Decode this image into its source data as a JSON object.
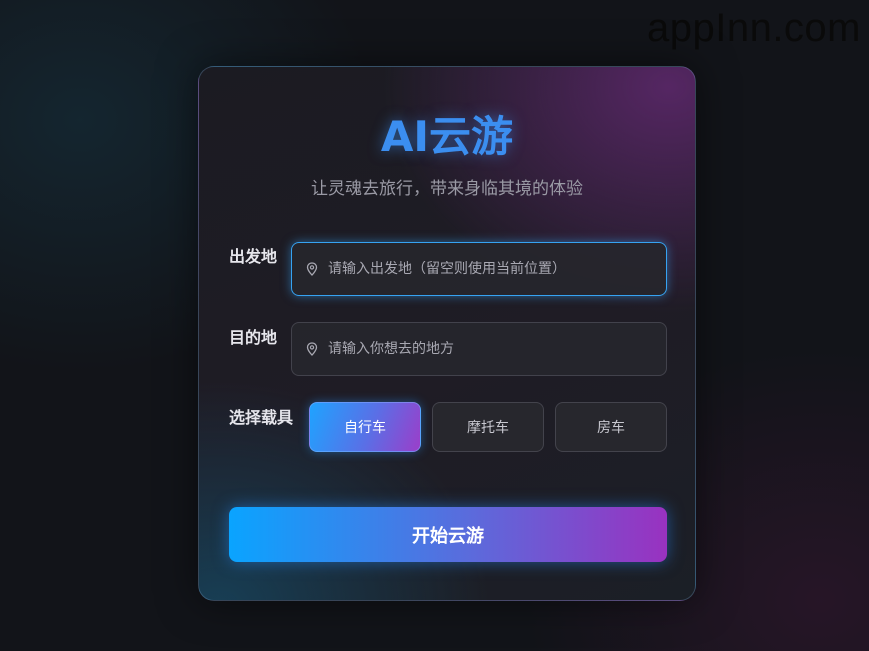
{
  "watermark": "appInn.com",
  "app": {
    "title": "AI云游",
    "subtitle": "让灵魂去旅行，带来身临其境的体验"
  },
  "form": {
    "origin": {
      "label": "出发地",
      "placeholder": "请输入出发地（留空则使用当前位置）",
      "value": "",
      "icon": "location-pin-icon"
    },
    "destination": {
      "label": "目的地",
      "placeholder": "请输入你想去的地方",
      "value": "",
      "icon": "location-pin-icon"
    },
    "vehicle": {
      "label": "选择载具",
      "options": [
        "自行车",
        "摩托车",
        "房车"
      ],
      "selected": "自行车"
    },
    "submit_label": "开始云游"
  },
  "colors": {
    "accent_blue": "#3b8ef0",
    "gradient_start": "#0aa4ff",
    "gradient_end": "#9932c0",
    "focus_border": "#36a3f2"
  }
}
